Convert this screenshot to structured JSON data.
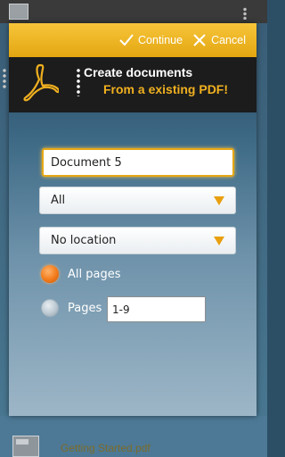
{
  "dialog": {
    "actions": {
      "continue_label": "Continue",
      "cancel_label": "Cancel"
    },
    "header": {
      "title": "Create documents",
      "subtitle": "From a existing PDF!"
    },
    "document_name": {
      "value": "Document 5"
    },
    "filter_select": {
      "selected": "All"
    },
    "location_select": {
      "selected": "No location"
    },
    "page_range": {
      "all_pages_label": "All pages",
      "pages_label": "Pages",
      "pages_value": "1-9",
      "selected_option": "All pages"
    }
  },
  "background": {
    "file_name": "Getting Started.pdf"
  },
  "colors": {
    "accent": "#f0b020",
    "action_bar": "#e8ac18",
    "header_bg": "#1c1c1c",
    "radio_selected": "#f27a1a"
  }
}
